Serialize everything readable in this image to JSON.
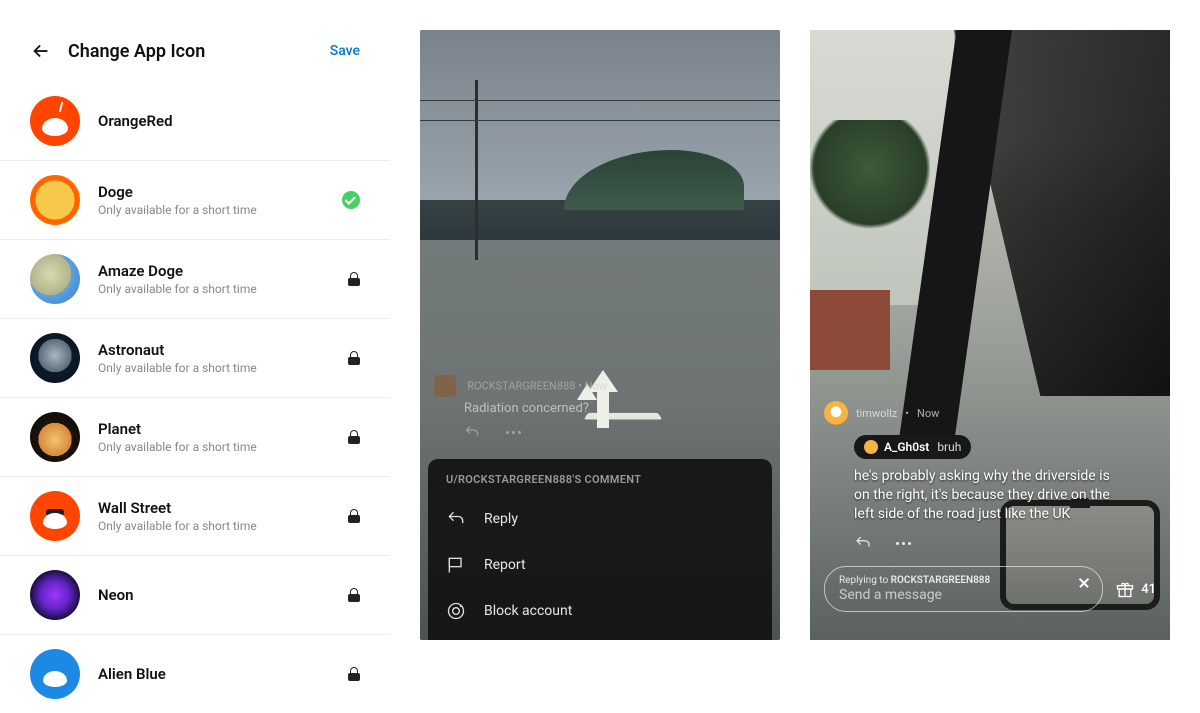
{
  "settings": {
    "title": "Change App Icon",
    "save_label": "Save",
    "subtext": "Only available for a short time",
    "icons": [
      {
        "key": "orangered",
        "name": "OrangeRed",
        "sub": false,
        "state": "none"
      },
      {
        "key": "doge",
        "name": "Doge",
        "sub": true,
        "state": "selected"
      },
      {
        "key": "amazedoge",
        "name": "Amaze Doge",
        "sub": true,
        "state": "locked"
      },
      {
        "key": "astronaut",
        "name": "Astronaut",
        "sub": true,
        "state": "locked"
      },
      {
        "key": "planet",
        "name": "Planet",
        "sub": true,
        "state": "locked"
      },
      {
        "key": "wallstreet",
        "name": "Wall Street",
        "sub": true,
        "state": "locked"
      },
      {
        "key": "neon",
        "name": "Neon",
        "sub": false,
        "state": "locked"
      },
      {
        "key": "alienblue",
        "name": "Alien Blue",
        "sub": false,
        "state": "locked"
      }
    ]
  },
  "sheet_panel": {
    "comment": {
      "user": "ROCKSTARGREEN888",
      "time": "Now",
      "body": "Radiation concerned?"
    },
    "header": "U/ROCKSTARGREEN888'S COMMENT",
    "actions": [
      {
        "key": "reply",
        "label": "Reply"
      },
      {
        "key": "report",
        "label": "Report"
      },
      {
        "key": "block",
        "label": "Block account"
      }
    ]
  },
  "reply_panel": {
    "user": "timwollz",
    "time": "Now",
    "badge_user": "A_Gh0st",
    "badge_text": "bruh",
    "body": "he's probably asking why the driverside is on the right, it's because they drive on the left side of the road just like the UK",
    "input": {
      "replying_prefix": "Replying to",
      "replying_user": "ROCKSTARGREEN888",
      "placeholder": "Send a message"
    },
    "award_count": "41"
  }
}
